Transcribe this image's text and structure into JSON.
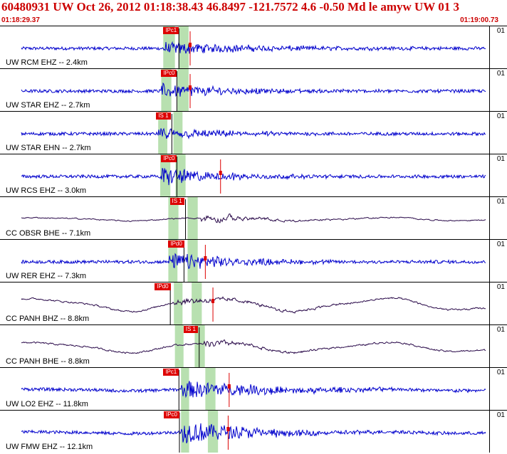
{
  "header": {
    "title": "60480931 UW Oct 26, 2012 01:18:38.43   46.8497 -121.7572  4.6 -0.50 Md le amyw UW 01   3",
    "start_time": "01:18:29.37",
    "end_time": "01:19:00.73"
  },
  "colors": {
    "title": "#cc0000",
    "trace_uw": "#0000cc",
    "trace_cc": "#2a0a4a",
    "pick": "#dd0000",
    "window": "#b8e0b0",
    "frame": "#000000"
  },
  "traces": [
    {
      "label": "UW RCM EHZ -- 2.4km",
      "chan": "01",
      "pick": "IPc1",
      "pick_x": 0.322,
      "win": [
        [
          0.322,
          0.345
        ],
        [
          0.352,
          0.372
        ]
      ],
      "onset": 0.322,
      "amp": 0.14,
      "dec": 0.2,
      "lp": 0.0,
      "color": "#0000cc",
      "red": [
        0.375
      ],
      "nwave": 0
    },
    {
      "label": "UW STAR EHZ -- 2.7km",
      "chan": "01",
      "pick": "IPc0",
      "pick_x": 0.318,
      "win": [
        [
          0.318,
          0.338
        ],
        [
          0.35,
          0.372
        ]
      ],
      "onset": 0.318,
      "amp": 0.16,
      "dec": 0.15,
      "lp": 0.0,
      "color": "#0000cc",
      "red": [
        0.375
      ],
      "nwave": 0
    },
    {
      "label": "UW STAR EHN -- 2.7km",
      "chan": "01",
      "pick": "IS 1",
      "pick_x": 0.308,
      "win": [
        [
          0.312,
          0.33
        ],
        [
          0.342,
          0.36
        ]
      ],
      "onset": 0.312,
      "amp": 0.14,
      "dec": 0.14,
      "lp": 0.0,
      "color": "#0000cc",
      "red": [],
      "nwave": 0
    },
    {
      "label": "UW RCS EHZ -- 3.0km",
      "chan": "01",
      "pick": "IPc0",
      "pick_x": 0.318,
      "win": [
        [
          0.316,
          0.336
        ],
        [
          0.346,
          0.366
        ]
      ],
      "onset": 0.316,
      "amp": 0.22,
      "dec": 0.12,
      "lp": 0.0,
      "color": "#0000cc",
      "red": [
        0.435
      ],
      "nwave": 0
    },
    {
      "label": "CC OBSR BHE -- 7.1km",
      "chan": "01",
      "pick": "IS 1",
      "pick_x": 0.335,
      "win": [
        [
          0.332,
          0.352
        ],
        [
          0.37,
          0.39
        ]
      ],
      "onset": 0.395,
      "amp": 0.28,
      "dec": 0.12,
      "lp": 0.7,
      "color": "#2a0a4a",
      "red": [],
      "nwave": 0.1
    },
    {
      "label": "UW RER EHZ -- 7.3km",
      "chan": "01",
      "pick": "IPd0",
      "pick_x": 0.332,
      "win": [
        [
          0.332,
          0.35
        ],
        [
          0.37,
          0.39
        ]
      ],
      "onset": 0.332,
      "amp": 0.2,
      "dec": 0.15,
      "lp": 0.0,
      "color": "#0000cc",
      "red": [
        0.405
      ],
      "nwave": 0
    },
    {
      "label": "CC PANH BHZ -- 8.8km",
      "chan": "01",
      "pick": "IPd0",
      "pick_x": 0.305,
      "win": [
        [
          0.343,
          0.36
        ],
        [
          0.378,
          0.398
        ]
      ],
      "onset": 0.343,
      "amp": 0.14,
      "dec": 0.18,
      "lp": 0.55,
      "color": "#2a0a4a",
      "red": [
        0.42
      ],
      "nwave": 0.38
    },
    {
      "label": "CC PANH BHE -- 8.8km",
      "chan": "01",
      "pick": "IS 1",
      "pick_x": 0.362,
      "win": [
        [
          0.345,
          0.362
        ],
        [
          0.384,
          0.404
        ]
      ],
      "onset": 0.402,
      "amp": 0.16,
      "dec": 0.1,
      "lp": 0.55,
      "color": "#2a0a4a",
      "red": [],
      "nwave": 0.3
    },
    {
      "label": "UW LO2 EHZ -- 11.8km",
      "chan": "01",
      "pick": "IPc1",
      "pick_x": 0.322,
      "win": [
        [
          0.357,
          0.373
        ],
        [
          0.405,
          0.425
        ]
      ],
      "onset": 0.357,
      "amp": 0.22,
      "dec": 0.18,
      "lp": 0.0,
      "color": "#0000cc",
      "red": [
        0.452
      ],
      "nwave": 0.05
    },
    {
      "label": "UW FMW EHZ -- 12.1km",
      "chan": "01",
      "pick": "IPc0",
      "pick_x": 0.323,
      "win": [
        [
          0.357,
          0.373
        ],
        [
          0.41,
          0.43
        ]
      ],
      "onset": 0.357,
      "amp": 0.28,
      "dec": 0.14,
      "lp": 0.0,
      "color": "#0000cc",
      "red": [
        0.45
      ],
      "nwave": 0.05
    }
  ]
}
